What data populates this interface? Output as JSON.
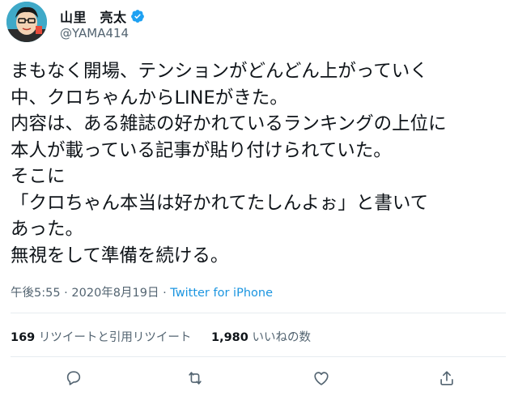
{
  "user": {
    "display_name": "山里　亮太",
    "handle": "@YAMA414",
    "verified_icon": "verified-badge-icon",
    "avatar_icon": "avatar"
  },
  "tweet": {
    "lines": [
      "まもなく開場、テンションがどんどん上がっていく",
      "中、クロちゃんからLINEがきた。",
      "内容は、ある雑誌の好かれているランキングの上位に",
      "本人が載っている記事が貼り付けられていた。",
      "そこに",
      "「クロちゃん本当は好かれてたしんよぉ」と書いて",
      "あった。",
      "無視をして準備を続ける。"
    ]
  },
  "meta": {
    "timestamp": "午後5:55 · 2020年8月19日 · ",
    "source": "Twitter for iPhone"
  },
  "stats": {
    "retweets_count": "169",
    "retweets_label": " リツイートと引用リツイート",
    "likes_count": "1,980",
    "likes_label": " いいねの数"
  },
  "actions": {
    "reply_icon": "reply-icon",
    "retweet_icon": "retweet-icon",
    "like_icon": "like-icon",
    "share_icon": "share-icon"
  },
  "colors": {
    "accent": "#1b95e0",
    "text": "#0f1419",
    "secondary": "#536471",
    "divider": "#e6ecf0"
  }
}
